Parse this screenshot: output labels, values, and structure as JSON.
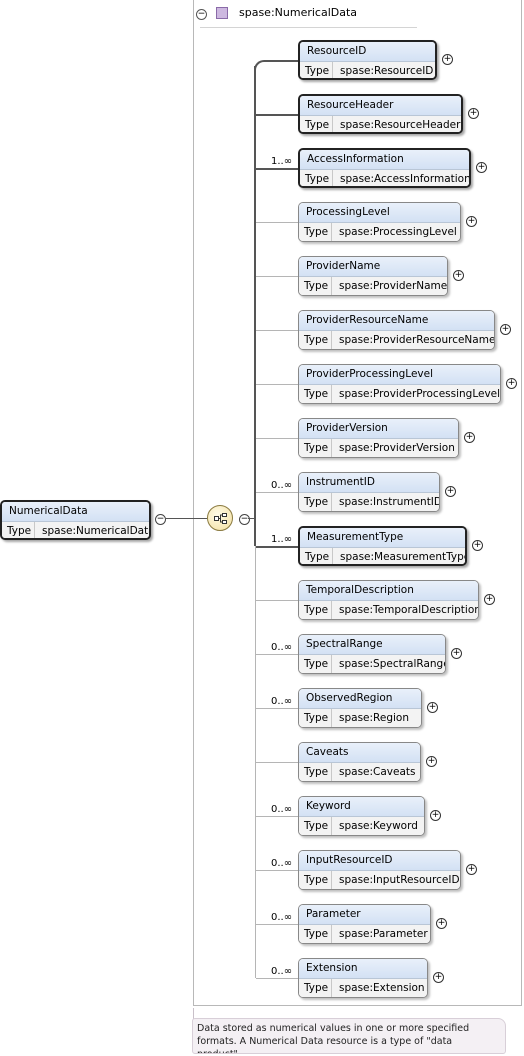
{
  "header": {
    "collapse_symbol": "−",
    "title": "spase:NumericalData"
  },
  "type_label": "Type",
  "root": {
    "name": "NumericalData",
    "type": "spase:NumericalData",
    "collapse_symbol": "−"
  },
  "sequence": {
    "collapse_symbol": "−"
  },
  "expand_symbol": "+",
  "elements": [
    {
      "name": "ResourceID",
      "type": "spase:ResourceID",
      "card": ""
    },
    {
      "name": "ResourceHeader",
      "type": "spase:ResourceHeader",
      "card": ""
    },
    {
      "name": "AccessInformation",
      "type": "spase:AccessInformation",
      "card": "1..∞"
    },
    {
      "name": "ProcessingLevel",
      "type": "spase:ProcessingLevel",
      "card": ""
    },
    {
      "name": "ProviderName",
      "type": "spase:ProviderName",
      "card": ""
    },
    {
      "name": "ProviderResourceName",
      "type": "spase:ProviderResourceName",
      "card": ""
    },
    {
      "name": "ProviderProcessingLevel",
      "type": "spase:ProviderProcessingLevel",
      "card": ""
    },
    {
      "name": "ProviderVersion",
      "type": "spase:ProviderVersion",
      "card": ""
    },
    {
      "name": "InstrumentID",
      "type": "spase:InstrumentID",
      "card": "0..∞"
    },
    {
      "name": "MeasurementType",
      "type": "spase:MeasurementType",
      "card": "1..∞"
    },
    {
      "name": "TemporalDescription",
      "type": "spase:TemporalDescription",
      "card": ""
    },
    {
      "name": "SpectralRange",
      "type": "spase:SpectralRange",
      "card": "0..∞"
    },
    {
      "name": "ObservedRegion",
      "type": "spase:Region",
      "card": "0..∞"
    },
    {
      "name": "Caveats",
      "type": "spase:Caveats",
      "card": ""
    },
    {
      "name": "Keyword",
      "type": "spase:Keyword",
      "card": "0..∞"
    },
    {
      "name": "InputResourceID",
      "type": "spase:InputResourceID",
      "card": "0..∞"
    },
    {
      "name": "Parameter",
      "type": "spase:Parameter",
      "card": "0..∞"
    },
    {
      "name": "Extension",
      "type": "spase:Extension",
      "card": "0..∞"
    }
  ],
  "annotation": {
    "line1": "Data stored as numerical values in one or more specified",
    "line2": "formats. A Numerical Data resource is a type of \"data product\"..."
  }
}
